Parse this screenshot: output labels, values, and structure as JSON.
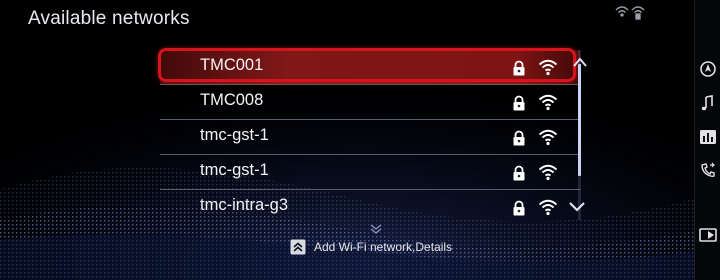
{
  "header": {
    "title": "Available networks"
  },
  "status_bar": {
    "icons": [
      "wifi-signal-icon",
      "wifi-hotspot-icon"
    ]
  },
  "networks": [
    {
      "name": "TMC001",
      "locked": true,
      "selected": true
    },
    {
      "name": "TMC008",
      "locked": true,
      "selected": false
    },
    {
      "name": "tmc-gst-1",
      "locked": true,
      "selected": false
    },
    {
      "name": "tmc-gst-1",
      "locked": true,
      "selected": false
    },
    {
      "name": "tmc-intra-g3",
      "locked": true,
      "selected": false
    }
  ],
  "footer": {
    "add_label": "Add Wi-Fi network,Details"
  },
  "sidebar": {
    "icons": [
      "navigation-icon",
      "music-note-icon",
      "equalizer-icon",
      "phone-icon",
      "media-icon"
    ]
  },
  "colors": {
    "selection_border": "#d6141c",
    "selection_fill": "#8c1616",
    "text": "#f4f4f6",
    "background": "#000000",
    "wave": "#3a4a88"
  }
}
